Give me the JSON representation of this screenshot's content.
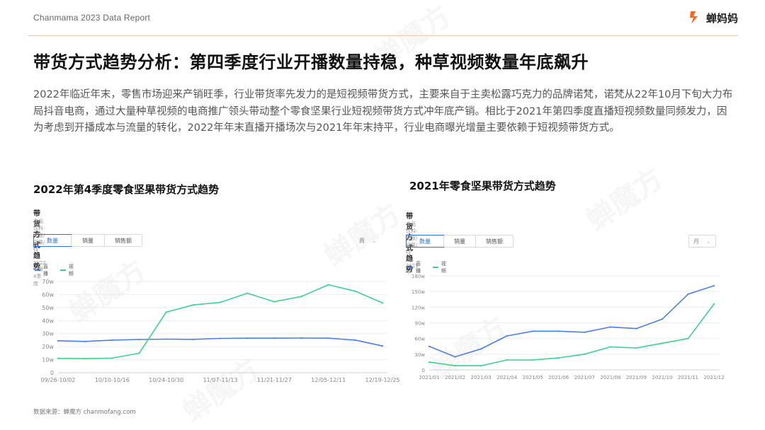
{
  "header": {
    "brand_text": "Chanmama 2023 Data Report",
    "logo_text": "蝉妈妈",
    "accent_color": "#f26b1d"
  },
  "page_title": "带货方式趋势分析：第四季度行业开播数量持稳，种草视频数量年底飙升",
  "intro_text": "2022年临近年末，零售市场迎来产销旺季，行业带货率先发力的是短视频带货方式，主要来自于主卖松露巧克力的品牌诺梵，诺梵从22年10月下旬大力布局抖音电商，通过大量种草视频的电商推广领头带动整个零食坚果行业短视频带货方式冲年底产销。相比于2021年第四季度直播短视频数量同频发力，因为考虑到开播成本与流量的转化，2022年年末直播开播场次与2021年年末持平，行业电商曝光增量主要依赖于短视频带货方式。",
  "source_text": "数据来源：蝉魔方 chanmofang.com",
  "watermark_text": "蝉魔方",
  "left": {
    "section_title": "2022年第4季度零食坚果带货方式趋势",
    "card_title": "带货方式趋势",
    "card_sub": "食品饮料-零食/坚果/特产，2022年第4季度",
    "tabs": [
      "数量",
      "销量",
      "销售额"
    ],
    "active_tab": 0,
    "period": "周"
  },
  "right": {
    "section_title": "2021年零食坚果带货方式趋势",
    "card_title": "带货方式趋势",
    "card_sub": "食品饮料-零食/坚果/特产，2021年",
    "tabs": [
      "数量",
      "销量",
      "销售额"
    ],
    "active_tab": 0,
    "period": "月"
  },
  "chart_data": [
    {
      "type": "line",
      "x_tick_labels": [
        "09/26-10/02",
        "10/10-10/16",
        "10/24-10/30",
        "11/07-11/13",
        "11/21-11/27",
        "12/05-12/11",
        "12/19-12/25"
      ],
      "x": [
        "09/26-10/02",
        "10/03-10/09",
        "10/10-10/16",
        "10/17-10/23",
        "10/24-10/30",
        "10/31-11/06",
        "11/07-11/13",
        "11/14-11/20",
        "11/21-11/27",
        "11/28-12/04",
        "12/05-12/11",
        "12/12-12/18",
        "12/19-12/25"
      ],
      "y_ticks": [
        "0",
        "10w",
        "20w",
        "30w",
        "40w",
        "50w",
        "60w",
        "70w"
      ],
      "ylim": [
        0,
        70
      ],
      "y_unit": "w",
      "grid": true,
      "legend_position": "top-left",
      "series": [
        {
          "name": "直播",
          "color": "#4a80e0",
          "values": [
            24.5,
            24,
            25,
            25.5,
            25.8,
            25.6,
            26.3,
            26.5,
            26.5,
            26.6,
            26.5,
            25,
            20.5
          ]
        },
        {
          "name": "视频",
          "color": "#3ed08f",
          "values": [
            11,
            10.8,
            11.2,
            15,
            46.5,
            52,
            54,
            61,
            54.5,
            58.5,
            67.5,
            62.5,
            53.5
          ]
        }
      ]
    },
    {
      "type": "line",
      "x": [
        "2021/01",
        "2021/02",
        "2021/03",
        "2021/04",
        "2021/05",
        "2021/06",
        "2021/07",
        "2021/08",
        "2021/09",
        "2021/10",
        "2021/11",
        "2021/12"
      ],
      "y_ticks": [
        "0",
        "30w",
        "60w",
        "90w",
        "120w",
        "150w",
        "180w"
      ],
      "ylim": [
        0,
        180
      ],
      "y_unit": "w",
      "grid": true,
      "legend_position": "top-left",
      "series": [
        {
          "name": "直播",
          "color": "#4a80e0",
          "values": [
            45,
            25,
            40,
            65,
            74,
            74,
            72,
            82,
            79,
            97,
            145,
            161
          ]
        },
        {
          "name": "视频",
          "color": "#3ed08f",
          "values": [
            15,
            8,
            8,
            19,
            19,
            23,
            30,
            44,
            42,
            51,
            60,
            126
          ]
        }
      ]
    }
  ]
}
